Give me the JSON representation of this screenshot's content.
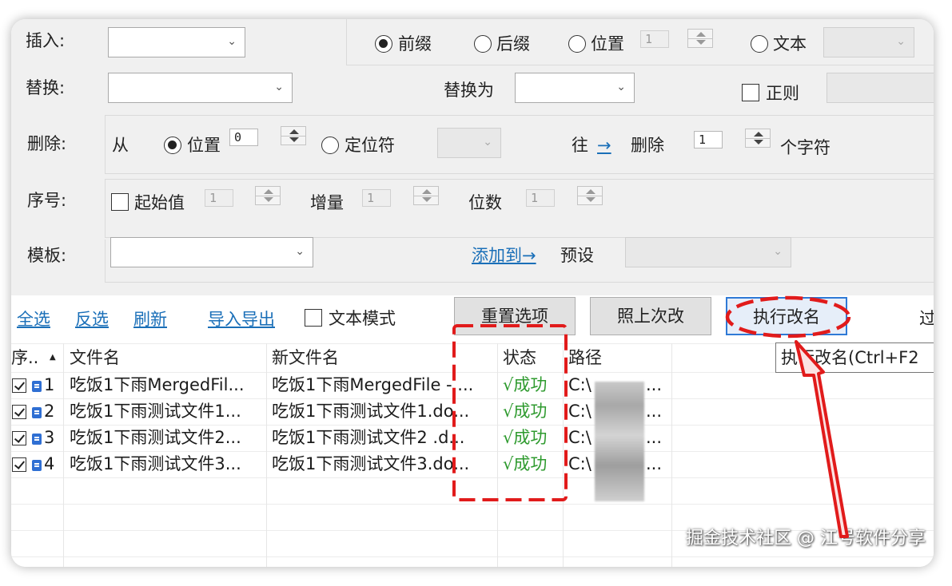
{
  "colors": {
    "link": "#1a6fb8",
    "success": "#2e9a2e",
    "annotation": "#e11b1b",
    "primary_border": "#2f7ad6"
  },
  "insert": {
    "label": "插入:",
    "opt_prefix": "前缀",
    "opt_suffix": "后缀",
    "opt_position": "位置",
    "position_value": "1",
    "opt_text": "文本",
    "selected": "前缀"
  },
  "replace": {
    "label": "替换:",
    "replace_with": "替换为",
    "regex_label": "正则"
  },
  "delete": {
    "label": "删除:",
    "from": "从",
    "opt_position": "位置",
    "position_value": "0",
    "opt_locator": "定位符",
    "toward": "往",
    "arrow": "→",
    "delete_word": "删除",
    "count_value": "1",
    "chars": "个字符"
  },
  "sequence": {
    "label": "序号:",
    "start_label": "起始值",
    "start_value": "1",
    "increment_label": "增量",
    "increment_value": "1",
    "digits_label": "位数",
    "digits_value": "1"
  },
  "template": {
    "label": "模板:",
    "add_to": "添加到→",
    "preset_label": "预设"
  },
  "toolbar": {
    "select_all": "全选",
    "invert": "反选",
    "refresh": "刷新",
    "import_export": "导入导出",
    "text_mode": "文本模式",
    "reset": "重置选项",
    "last_change": "照上次改",
    "execute": "执行改名",
    "filter_partial": "过"
  },
  "tooltip": "执行改名(Ctrl+F2",
  "table": {
    "headers": {
      "seq": "序..",
      "sort_indicator": "▲",
      "filename": "文件名",
      "new_filename": "新文件名",
      "status": "状态",
      "path": "路径"
    },
    "rows": [
      {
        "seq": "1",
        "filename": "吃饭1下雨MergedFil...",
        "new_filename": "吃饭1下雨MergedFile - ...",
        "status": "√成功",
        "path": "C:\\",
        "path_tail": "..."
      },
      {
        "seq": "2",
        "filename": "吃饭1下雨测试文件1...",
        "new_filename": "吃饭1下雨测试文件1.do...",
        "status": "√成功",
        "path": "C:\\",
        "path_tail": "..."
      },
      {
        "seq": "3",
        "filename": "吃饭1下雨测试文件2...",
        "new_filename": "吃饭1下雨测试文件2 .d...",
        "status": "√成功",
        "path": "C:\\",
        "path_tail": "..."
      },
      {
        "seq": "4",
        "filename": "吃饭1下雨测试文件3...",
        "new_filename": "吃饭1下雨测试文件3.do...",
        "status": "√成功",
        "path": "C:\\",
        "path_tail": "..."
      }
    ]
  },
  "watermark": "掘金技术社区 @ 江号软件分享"
}
